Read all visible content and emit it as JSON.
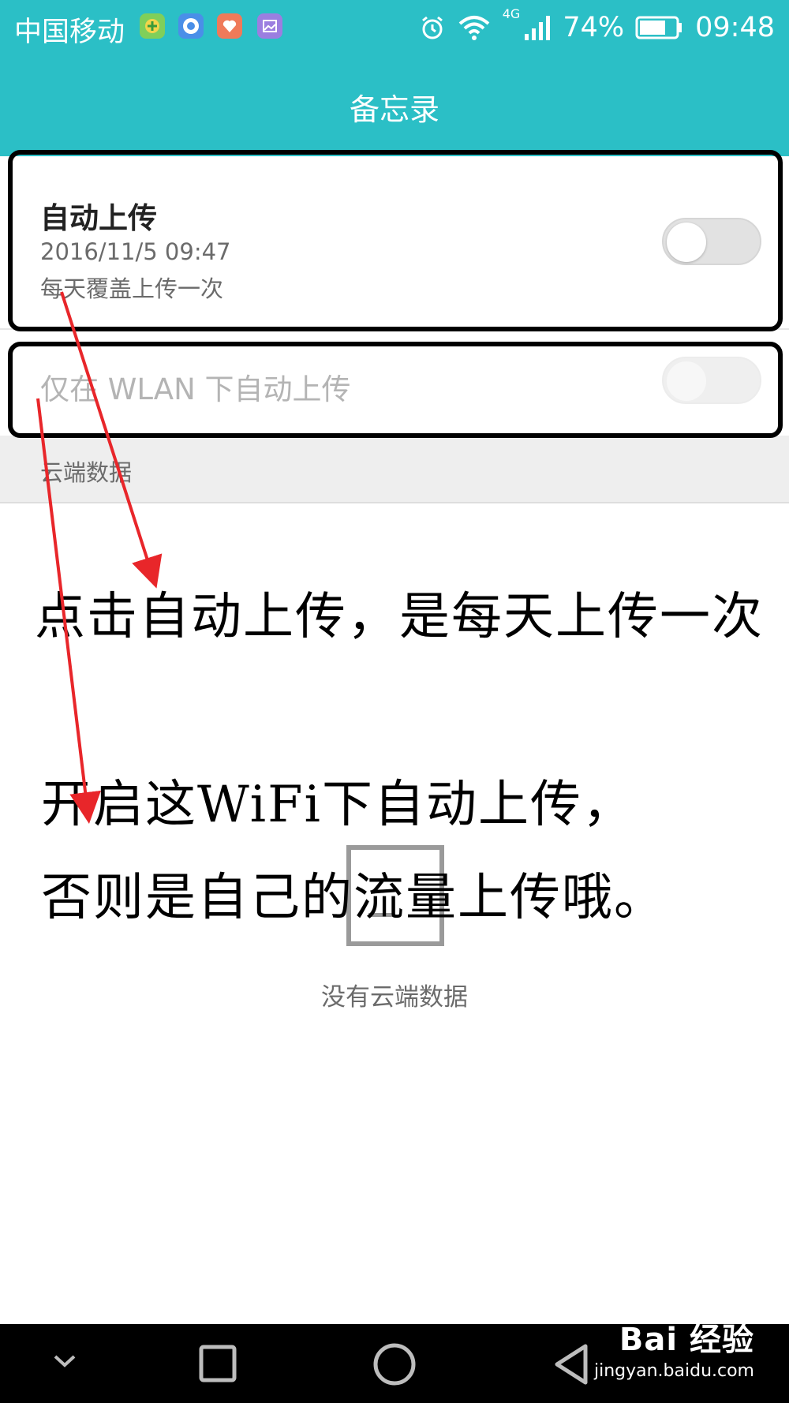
{
  "status_bar": {
    "carrier": "中国移动",
    "network": "4G",
    "battery": "74%",
    "time": "09:48",
    "icons": [
      "notification-app-icon",
      "shield-app-icon",
      "health-app-icon",
      "gallery-app-icon",
      "alarm-icon",
      "wifi-icon",
      "signal-icon",
      "battery-icon"
    ]
  },
  "header": {
    "title": "备忘录"
  },
  "settings": {
    "auto_upload": {
      "title": "自动上传",
      "date": "2016/11/5 09:47",
      "description": "每天覆盖上传一次",
      "enabled": false
    },
    "wlan_only": {
      "title": "仅在 WLAN 下自动上传",
      "enabled": false,
      "disabled": true
    }
  },
  "section": {
    "label": "云端数据"
  },
  "empty_state": {
    "text": "没有云端数据"
  },
  "annotations": {
    "line1": "点击自动上传，是每天上传一次",
    "line2": "开启这WiFi下自动上传，",
    "line3": "否则是自己的流量上传哦。",
    "arrow_color": "#e8262a"
  },
  "nav_bar": {
    "buttons": [
      "collapse-icon",
      "recents-icon",
      "home-icon",
      "back-icon"
    ]
  },
  "watermark": {
    "brand": "Bai 经验",
    "url": "jingyan.baidu.com"
  }
}
